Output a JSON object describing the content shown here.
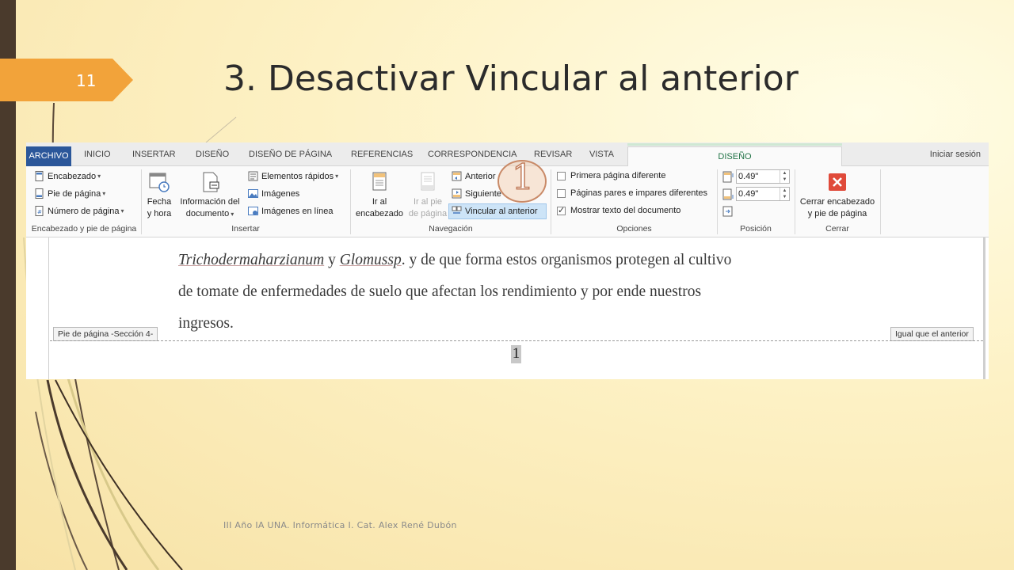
{
  "slide": {
    "number": "11",
    "title": "3. Desactivar Vincular al anterior",
    "footer": "III Año IA UNA. Informática I. Cat. Alex René Dubón",
    "callout_number": "1"
  },
  "ribbon_tabs": [
    "ARCHIVO",
    "INICIO",
    "INSERTAR",
    "DISEÑO",
    "DISEÑO DE PÁGINA",
    "REFERENCIAS",
    "CORRESPONDENCIA",
    "REVISAR",
    "VISTA"
  ],
  "active_tab": "DISEÑO",
  "sign_in": "Iniciar sesión",
  "groups": {
    "header_footer": {
      "label": "Encabezado y pie de página",
      "items": [
        "Encabezado",
        "Pie de página",
        "Número de página"
      ]
    },
    "insert": {
      "label": "Insertar",
      "date_time": [
        "Fecha",
        "y hora"
      ],
      "doc_info": [
        "Información del",
        "documento"
      ],
      "items": [
        "Elementos rápidos",
        "Imágenes",
        "Imágenes en línea"
      ]
    },
    "navigation": {
      "label": "Navegación",
      "goto_header": [
        "Ir al",
        "encabezado"
      ],
      "goto_footer": [
        "Ir al pie",
        "de página"
      ],
      "items": [
        "Anterior",
        "Siguiente",
        "Vincular al anterior"
      ]
    },
    "options": {
      "label": "Opciones",
      "items": [
        {
          "label": "Primera página diferente",
          "checked": false
        },
        {
          "label": "Páginas pares e impares diferentes",
          "checked": false
        },
        {
          "label": "Mostrar texto del documento",
          "checked": true
        }
      ]
    },
    "position": {
      "label": "Posición",
      "header_from_top": "0.49\"",
      "footer_from_bottom": "0.49\""
    },
    "close": {
      "label": "Cerrar",
      "button": [
        "Cerrar encabezado",
        "y pie de página"
      ]
    }
  },
  "document": {
    "term1": "Trichodermaharzianum",
    "word_y": "y",
    "term2": "Glomussp",
    "line1_rest": ". y de que forma estos organismos protegen al cultivo",
    "line2": "de tomate de enfermedades de suelo que afectan los rendimiento y por ende nuestros",
    "line3": "ingresos.",
    "footer_label": "Pie de página -Sección 4-",
    "same_as_previous": "Igual que el anterior",
    "page_number": "1"
  },
  "colors": {
    "accent_orange": "#f2a33a",
    "file_tab_blue": "#2b579a",
    "active_tab_green": "#217346",
    "close_red": "#e04a3a",
    "highlight_blue": "#cde4f7"
  }
}
